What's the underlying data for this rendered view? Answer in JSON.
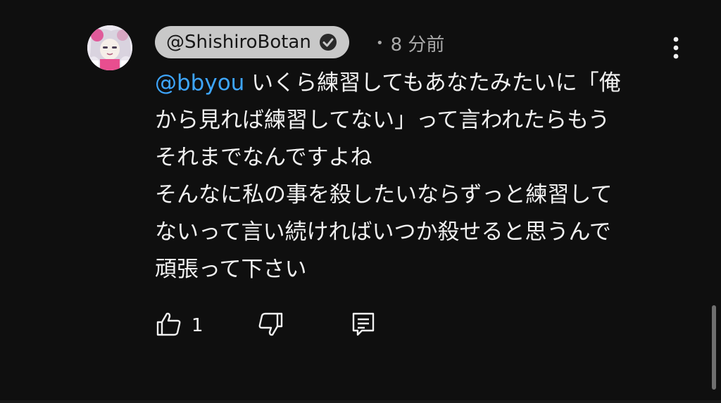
{
  "comment": {
    "author": "@ShishiroBotan",
    "time": "8 分前",
    "dot": "•",
    "mention": "@bbyou",
    "text_lines": [
      " いくら練習してもあなたみたいに「俺",
      "から見れば練習してない」って言われたらもう",
      "それまでなんですよね",
      "そんなに私の事を殺したいならずっと練習して",
      "ないって言い続ければいつか殺せると思うんで",
      "頑張って下さい"
    ],
    "like_count": "1"
  },
  "icons": {
    "author_badge": "verified-check-icon",
    "menu": "more-vertical-icon",
    "like": "thumb-up-icon",
    "dislike": "thumb-down-icon",
    "reply": "reply-comment-icon"
  },
  "colors": {
    "background": "#0f0f0f",
    "mention": "#3ea6ff",
    "author_chip": "#c8c8c8",
    "meta_text": "#aaaaaa"
  }
}
